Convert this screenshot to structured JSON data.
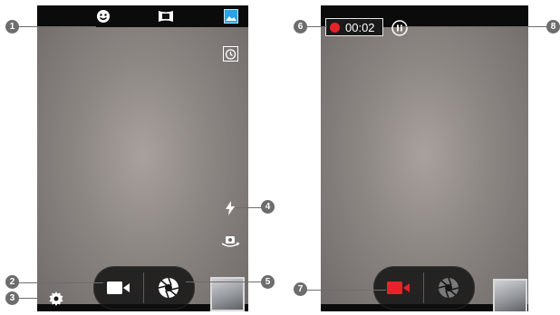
{
  "left_screen": {
    "top_icons": [
      "face-icon",
      "panorama-icon",
      "gallery-icon"
    ],
    "side_icons": [
      "timer-icon",
      "flash-icon",
      "switch-camera-icon"
    ],
    "controls": [
      "video-record-icon",
      "shutter-icon"
    ],
    "settings_icon": "gear-icon"
  },
  "right_screen": {
    "recording_time": "00:02",
    "controls": [
      "stop-record-icon",
      "shutter-icon"
    ],
    "pause_icon": "pause-icon"
  },
  "callouts": {
    "c1": "1",
    "c2": "2",
    "c3": "3",
    "c4": "4",
    "c5": "5",
    "c6": "6",
    "c7": "7",
    "c8": "8"
  },
  "colors": {
    "record_red": "#e8222a",
    "bar_black": "#0b0b0b",
    "callout_gray": "#6d6d6d"
  }
}
